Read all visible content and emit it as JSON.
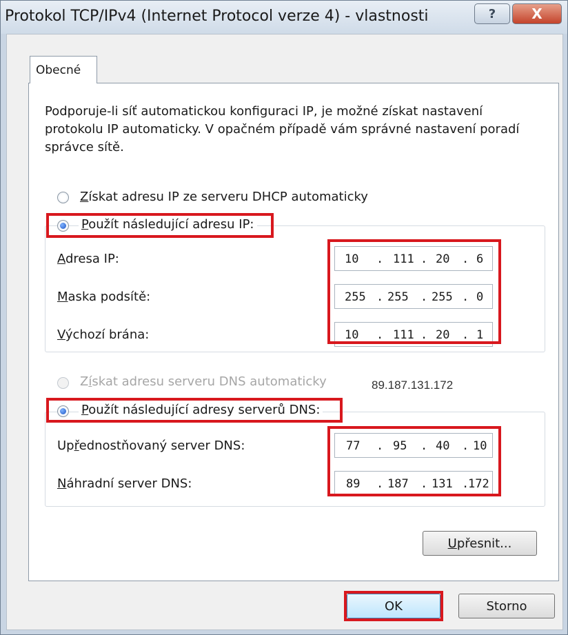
{
  "window": {
    "title": "Protokol TCP/IPv4 (Internet Protocol verze 4) - vlastnosti",
    "help_glyph": "?",
    "close_glyph": "X"
  },
  "tab": {
    "label": "Obecné"
  },
  "intro_text": "Podporuje-li síť automatickou konfiguraci IP, je možné získat nastavení protokolu IP automaticky. V opačném případě vám správné nastavení poradí správce sítě.",
  "ip_section": {
    "auto_option": {
      "label_key": "Z",
      "label_rest": "ískat adresu IP ze serveru DHCP automaticky",
      "checked": false
    },
    "manual_option": {
      "label_key": "P",
      "label_rest": "oužít následující adresu IP:",
      "checked": true
    },
    "fields": [
      {
        "label_key": "A",
        "label_rest": "dresa IP:",
        "octets": [
          "10",
          "111",
          "20",
          "6"
        ]
      },
      {
        "label_key": "M",
        "label_rest": "aska podsítě:",
        "octets": [
          "255",
          "255",
          "255",
          "0"
        ]
      },
      {
        "label_key": "V",
        "label_rest": "ýchozí brána:",
        "octets": [
          "10",
          "111",
          "20",
          "1"
        ]
      }
    ]
  },
  "dns_section": {
    "auto_option": {
      "label_pre": "Z",
      "label_key": "í",
      "label_rest": "skat adresu serveru DNS automaticky",
      "checked": false,
      "disabled": true
    },
    "annotation": "89.187.131.172",
    "manual_option": {
      "label_key": "P",
      "label_rest": "oužít následující adresy serverů DNS:",
      "checked": true
    },
    "fields": [
      {
        "label_pre": "Up",
        "label_key": "ř",
        "label_rest": "ednostňovaný server DNS:",
        "octets": [
          "77",
          "95",
          "40",
          "10"
        ]
      },
      {
        "label_pre": "",
        "label_key": "N",
        "label_rest": "áhradní server DNS:",
        "octets": [
          "89",
          "187",
          "131",
          "172"
        ]
      }
    ]
  },
  "buttons": {
    "advanced": {
      "label_key": "U",
      "label_rest": "přesnit..."
    },
    "ok": "OK",
    "cancel": "Storno"
  },
  "colors": {
    "highlight": "#d8181e",
    "close_button": "#c4432b",
    "window_frame": "#c9d5e3"
  },
  "icons": [
    "help-icon",
    "close-icon",
    "radio-unchecked-icon",
    "radio-checked-icon"
  ]
}
